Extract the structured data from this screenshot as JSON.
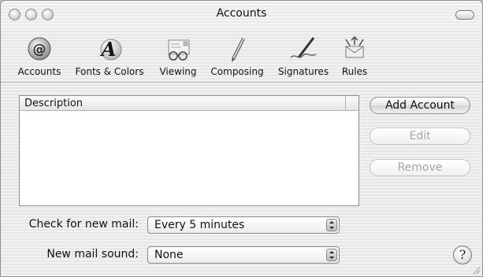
{
  "window": {
    "title": "Accounts"
  },
  "toolbar": {
    "items": [
      {
        "label": "Accounts",
        "icon": "at-sign-icon"
      },
      {
        "label": "Fonts & Colors",
        "icon": "font-a-icon"
      },
      {
        "label": "Viewing",
        "icon": "glasses-letter-icon"
      },
      {
        "label": "Composing",
        "icon": "pencil-icon"
      },
      {
        "label": "Signatures",
        "icon": "pen-signature-icon"
      },
      {
        "label": "Rules",
        "icon": "rules-envelope-icon"
      }
    ]
  },
  "accounts_list": {
    "column_header": "Description",
    "rows": []
  },
  "buttons": {
    "add_account": "Add Account",
    "edit": "Edit",
    "remove": "Remove"
  },
  "settings": {
    "check_mail_label": "Check for new mail:",
    "check_mail_value": "Every 5 minutes",
    "mail_sound_label": "New mail sound:",
    "mail_sound_value": "None"
  },
  "help": {
    "glyph": "?"
  }
}
